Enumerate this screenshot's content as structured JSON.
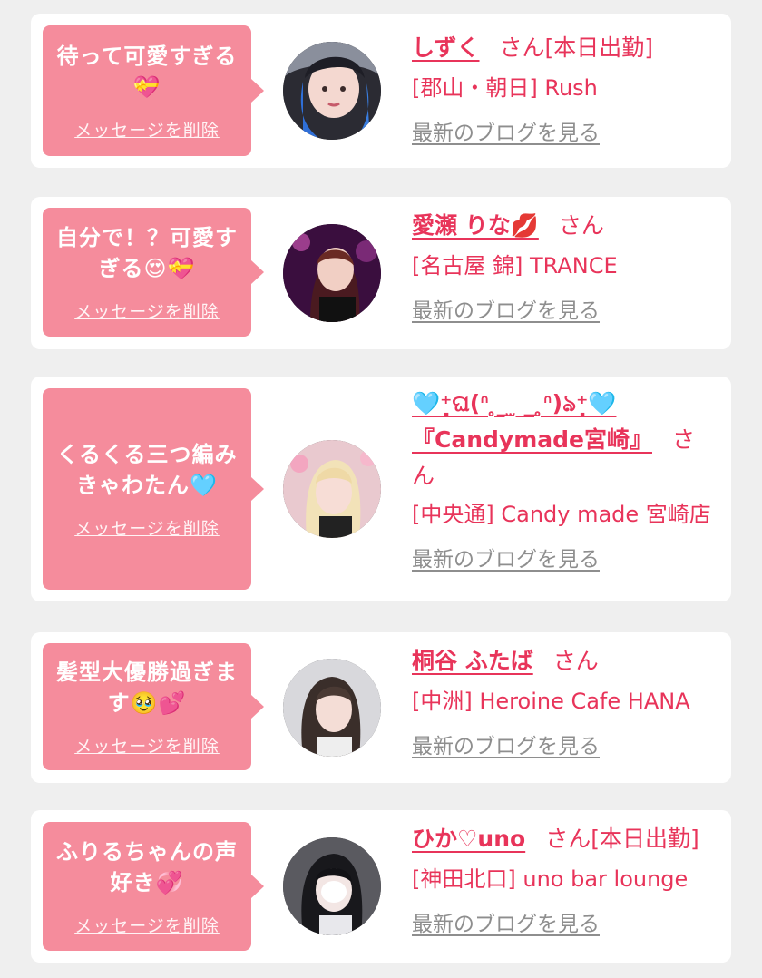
{
  "delete_label": "メッセージを削除",
  "san_label": "さん",
  "blog_label": "最新のブログを見る",
  "colors": {
    "bubble": "#f58c9c",
    "accent": "#e8345a",
    "link_gray": "#8e8e8e",
    "background": "#efefef"
  },
  "messages": [
    {
      "text": "待って可愛すぎる💝",
      "name": "しずく",
      "status": "[本日出勤]",
      "shop": "[郡山・朝日] Rush"
    },
    {
      "text": "自分で！？可愛すぎる😍💝",
      "name": "愛瀬 りな💋",
      "status": "",
      "shop": "[名古屋 錦] TRANCE"
    },
    {
      "text": "くるくる三つ編みきゃわたん🩵",
      "name": "🩵⁺̣ଘ(ᐢ ̥_ ̫ _ ̥ᐢ)ঌ⁺̣🩵 『Candymade宮崎』",
      "status": "",
      "shop": "[中央通] Candy made 宮崎店"
    },
    {
      "text": "髪型大優勝過ぎます🥹💕",
      "name": "桐谷 ふたば",
      "status": "",
      "shop": "[中洲] Heroine Cafe HANA"
    },
    {
      "text": "ふりるちゃんの声好き💞",
      "name": "ひか♡uno",
      "status": "[本日出勤]",
      "shop": "[神田北口] uno bar lounge"
    }
  ]
}
